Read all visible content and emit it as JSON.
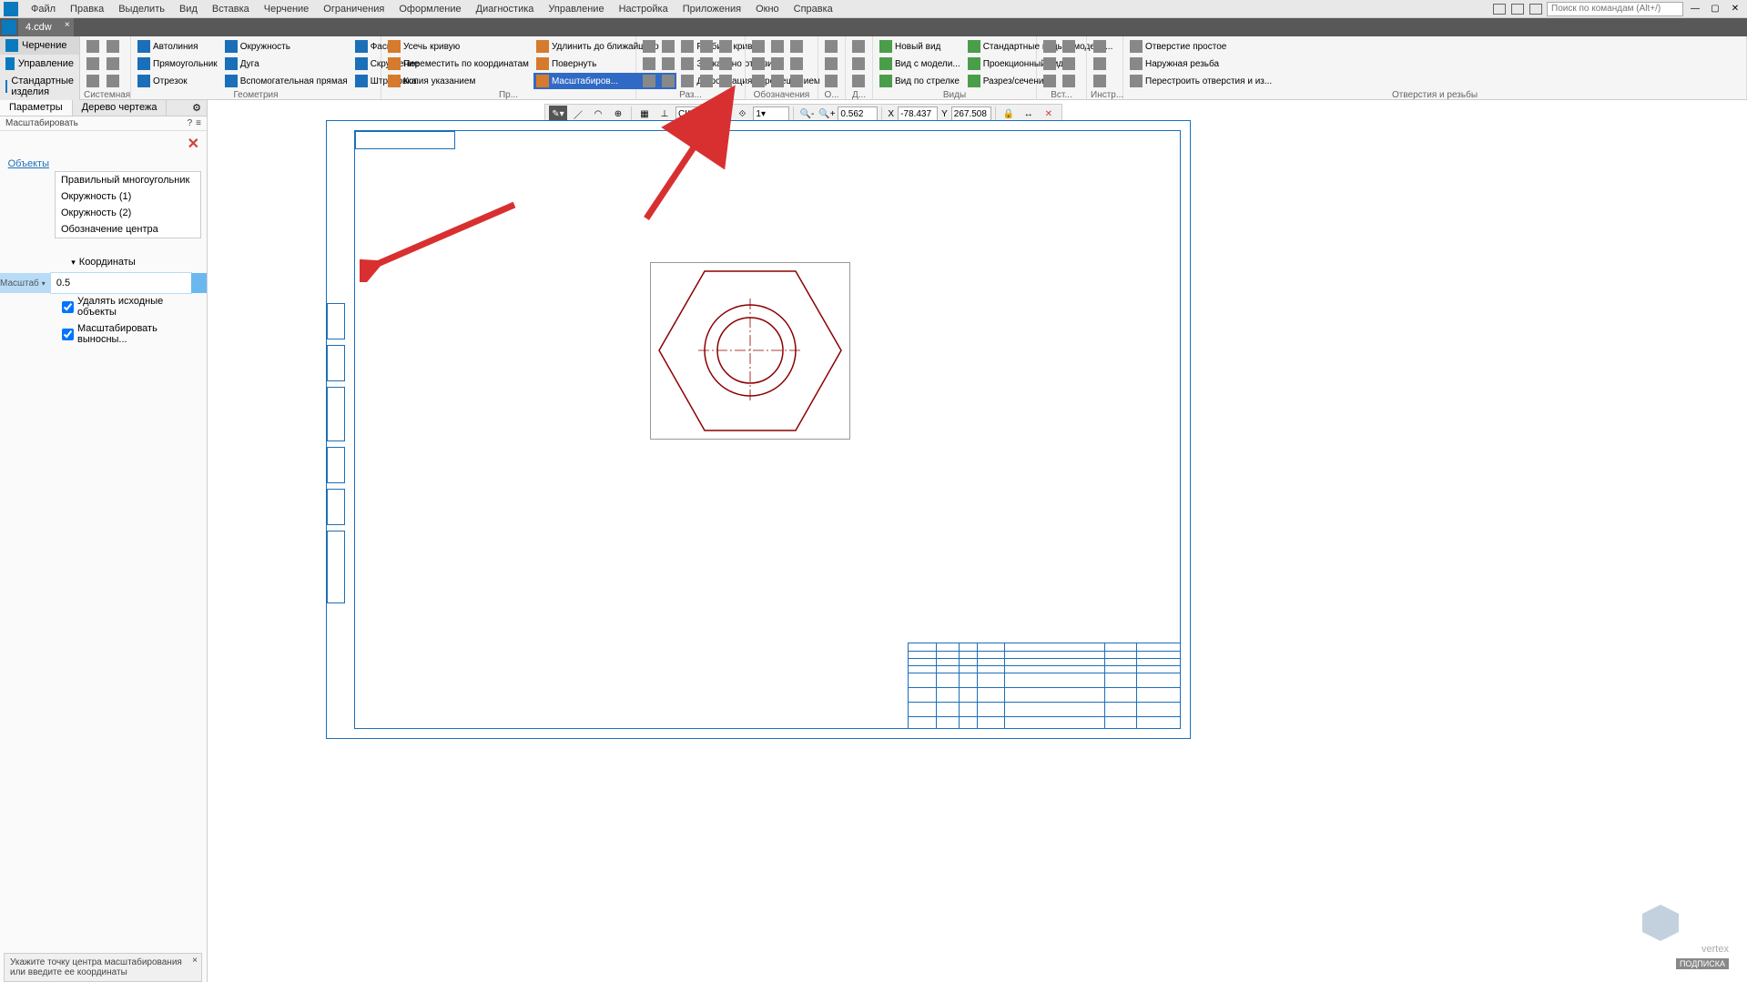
{
  "menu": {
    "items": [
      "Файл",
      "Правка",
      "Выделить",
      "Вид",
      "Вставка",
      "Черчение",
      "Ограничения",
      "Оформление",
      "Диагностика",
      "Управление",
      "Настройка",
      "Приложения",
      "Окно",
      "Справка"
    ],
    "search_placeholder": "Поиск по командам (Alt+/)"
  },
  "filetab": {
    "name": "4.cdw"
  },
  "modes": {
    "drawing": "Черчение",
    "manage": "Управление",
    "std": "Стандартные изделия"
  },
  "ribbon": {
    "system": {
      "label": "Системная"
    },
    "geometry": {
      "label": "Геометрия",
      "autoline": "Автолиния",
      "circle": "Окружность",
      "chamfer": "Фаска",
      "rect": "Прямоугольник",
      "arc": "Дуга",
      "fillet": "Скругление",
      "segment": "Отрезок",
      "auxline": "Вспомогательная прямая",
      "hatch": "Штриховка"
    },
    "edit": {
      "label": "Пр...",
      "trim": "Усечь кривую",
      "extend": "Удлинить до ближайшего о...",
      "move": "Переместить по координатам",
      "split": "Разбить кривую",
      "copy": "Копия указанием",
      "rotate": "Повернуть",
      "mirror": "Зеркально отразить",
      "scale": "Масштабиров...",
      "deform": "Деформация перемещением"
    },
    "dim": {
      "label": "Раз..."
    },
    "annot": {
      "label": "Обозначения"
    },
    "constr": {
      "label": "О..."
    },
    "diag": {
      "label": "Д..."
    },
    "views": {
      "label": "Виды",
      "newview": "Новый вид",
      "model": "Вид с модели...",
      "arrow": "Вид по стрелке",
      "stdviews": "Стандартные виды с модели...",
      "proj": "Проекционный вид",
      "section": "Разрез/сечение"
    },
    "insert": {
      "label": "Вст..."
    },
    "tools": {
      "label": "Инстр..."
    },
    "holes": {
      "label": "Отверстия и резьбы",
      "simple": "Отверстие простое",
      "ext": "Наружная резьба",
      "rebuild": "Перестроить отверстия и из..."
    }
  },
  "float": {
    "cs_label": "СК 0",
    "scale_value": "1",
    "zoom": "0.562",
    "x_label": "X",
    "x_value": "-78.437",
    "y_label": "Y",
    "y_value": "267.508"
  },
  "panel": {
    "tab_params": "Параметры",
    "tab_tree": "Дерево чертежа",
    "subtitle": "Масштабировать",
    "objects_label": "Объекты",
    "objects": [
      "Правильный многоугольник",
      "Окружность (1)",
      "Окружность (2)",
      "Обозначение центра"
    ],
    "coords_section": "Координаты",
    "scale_label": "Масштаб",
    "scale_value": "0.5",
    "check1": "Удалять исходные объекты",
    "check2": "Масштабировать выносны..."
  },
  "status": {
    "hint": "Укажите точку центра масштабирования или введите ее координаты"
  },
  "watermark": {
    "brand": "vertex",
    "sub": "ПОДПИСКА"
  }
}
